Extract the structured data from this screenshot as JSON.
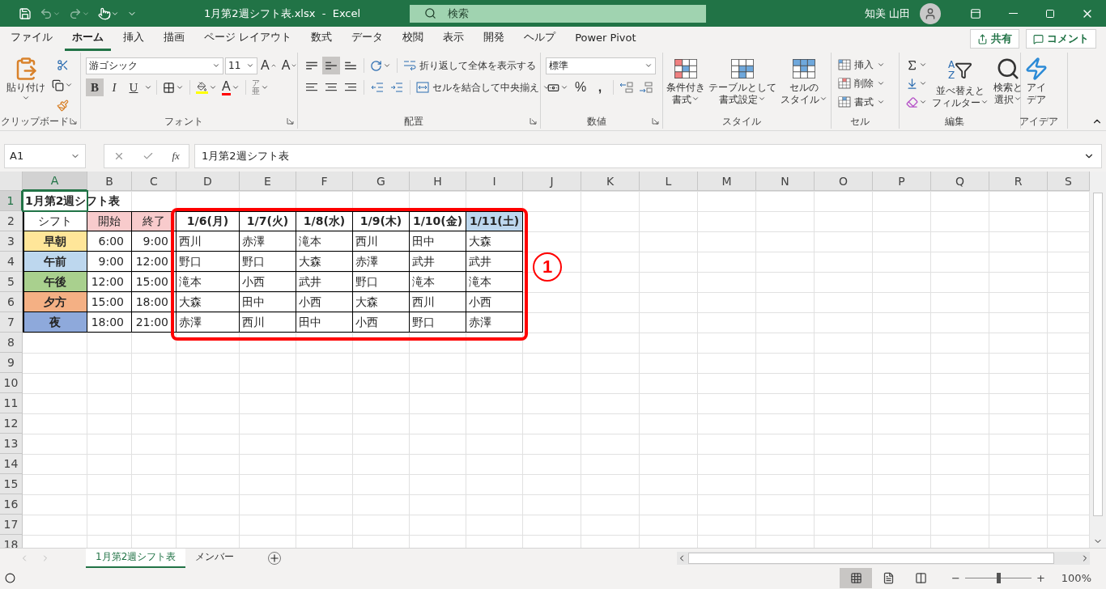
{
  "title_bar": {
    "file_title": "1月第2週シフト表.xlsx  -  Excel",
    "search_placeholder": "検索",
    "user_name": "知美 山田"
  },
  "menu_tabs": [
    {
      "label": "ファイル",
      "selected": false
    },
    {
      "label": "ホーム",
      "selected": true
    },
    {
      "label": "挿入",
      "selected": false
    },
    {
      "label": "描画",
      "selected": false
    },
    {
      "label": "ページ レイアウト",
      "selected": false
    },
    {
      "label": "数式",
      "selected": false
    },
    {
      "label": "データ",
      "selected": false
    },
    {
      "label": "校閲",
      "selected": false
    },
    {
      "label": "表示",
      "selected": false
    },
    {
      "label": "開発",
      "selected": false
    },
    {
      "label": "ヘルプ",
      "selected": false
    },
    {
      "label": "Power Pivot",
      "selected": false
    }
  ],
  "share_button": "共有",
  "comment_button": "コメント",
  "ribbon": {
    "groups": [
      {
        "kind": "clipboard",
        "label": "クリップボード",
        "paste": "貼り付け"
      },
      {
        "kind": "font",
        "label": "フォント",
        "font_name": "游ゴシック",
        "font_size": "11",
        "grow": "A",
        "shrink": "A",
        "styles": [
          {
            "kind": "bold",
            "label": "B",
            "selected": true
          },
          {
            "kind": "italic",
            "label": "I",
            "selected": false
          },
          {
            "kind": "underline",
            "label": "U",
            "selected": false
          }
        ],
        "font_color_letter": "A",
        "phonetic": [
          "ア",
          "亜"
        ]
      },
      {
        "kind": "alignment",
        "label": "配置",
        "vertical": [
          {
            "kind": "top",
            "selected": false
          },
          {
            "kind": "middle",
            "selected": true
          },
          {
            "kind": "bottom",
            "selected": false
          }
        ],
        "wrap": "折り返して全体を表示する",
        "merge": "セルを結合して中央揃え"
      },
      {
        "kind": "number",
        "label": "数値",
        "format": "標準",
        "percent": "%",
        "comma": ","
      },
      {
        "kind": "styles",
        "label": "スタイル",
        "buttons": [
          {
            "kind": "conditional",
            "lines": [
              "条件付き",
              "書式"
            ]
          },
          {
            "kind": "table",
            "lines": [
              "テーブルとして",
              "書式設定"
            ]
          },
          {
            "kind": "cell",
            "lines": [
              "セルの",
              "スタイル"
            ]
          }
        ]
      },
      {
        "kind": "cells",
        "label": "セル",
        "buttons": [
          {
            "kind": "insert",
            "label": "挿入"
          },
          {
            "kind": "delete",
            "label": "削除"
          },
          {
            "kind": "format",
            "label": "書式"
          }
        ]
      },
      {
        "kind": "editing",
        "label": "編集",
        "sort_letters": [
          "A",
          "Z"
        ],
        "sort": [
          "並べ替えと",
          "フィルター"
        ],
        "find": [
          "検索と",
          "選択"
        ]
      },
      {
        "kind": "ideas",
        "label": "アイデア",
        "lines": [
          "アイ",
          "デア"
        ]
      }
    ]
  },
  "formula_bar": {
    "name_box": "A1",
    "fx": "fx",
    "formula": "1月第2週シフト表"
  },
  "sheet": {
    "columns": [
      {
        "label": "A",
        "selected": true
      },
      {
        "label": "B",
        "selected": false
      },
      {
        "label": "C",
        "selected": false
      },
      {
        "label": "D",
        "selected": false
      },
      {
        "label": "E",
        "selected": false
      },
      {
        "label": "F",
        "selected": false
      },
      {
        "label": "G",
        "selected": false
      },
      {
        "label": "H",
        "selected": false
      },
      {
        "label": "I",
        "selected": false
      },
      {
        "label": "J",
        "selected": false
      },
      {
        "label": "K",
        "selected": false
      },
      {
        "label": "L",
        "selected": false
      },
      {
        "label": "M",
        "selected": false
      },
      {
        "label": "N",
        "selected": false
      },
      {
        "label": "O",
        "selected": false
      },
      {
        "label": "P",
        "selected": false
      },
      {
        "label": "Q",
        "selected": false
      },
      {
        "label": "R",
        "selected": false
      },
      {
        "label": "S",
        "selected": false
      }
    ],
    "rows": [
      {
        "label": "1",
        "selected": true,
        "cells": [
          {
            "kind": "title",
            "text": "1月第2週シフト表"
          }
        ]
      },
      {
        "label": "2",
        "selected": false,
        "cells": [
          {
            "kind": "label",
            "text": "シフト"
          },
          {
            "kind": "label",
            "text": "開始",
            "color": "#f8cbcc"
          },
          {
            "kind": "label",
            "text": "終了",
            "color": "#f8cbcc"
          },
          {
            "kind": "day",
            "text": "1/6(月)"
          },
          {
            "kind": "day",
            "text": "1/7(火)"
          },
          {
            "kind": "day",
            "text": "1/8(水)"
          },
          {
            "kind": "day",
            "text": "1/9(木)"
          },
          {
            "kind": "day",
            "text": "1/10(金)"
          },
          {
            "kind": "day",
            "text": "1/11(土)",
            "color": "#bdd7ee"
          }
        ]
      },
      {
        "label": "3",
        "selected": false,
        "cells": [
          {
            "kind": "shift",
            "text": "早朝",
            "color": "#ffe699"
          },
          {
            "kind": "time",
            "text": "6:00"
          },
          {
            "kind": "time",
            "text": "9:00"
          },
          {
            "kind": "name",
            "text": "西川"
          },
          {
            "kind": "name",
            "text": "赤澤"
          },
          {
            "kind": "name",
            "text": "滝本"
          },
          {
            "kind": "name",
            "text": "西川"
          },
          {
            "kind": "name",
            "text": "田中"
          },
          {
            "kind": "name",
            "text": "大森"
          }
        ]
      },
      {
        "label": "4",
        "selected": false,
        "cells": [
          {
            "kind": "shift",
            "text": "午前",
            "color": "#bdd7ee"
          },
          {
            "kind": "time",
            "text": "9:00"
          },
          {
            "kind": "time",
            "text": "12:00"
          },
          {
            "kind": "name",
            "text": "野口"
          },
          {
            "kind": "name",
            "text": "野口"
          },
          {
            "kind": "name",
            "text": "大森"
          },
          {
            "kind": "name",
            "text": "赤澤"
          },
          {
            "kind": "name",
            "text": "武井"
          },
          {
            "kind": "name",
            "text": "武井"
          }
        ]
      },
      {
        "label": "5",
        "selected": false,
        "cells": [
          {
            "kind": "shift",
            "text": "午後",
            "color": "#a9d08e"
          },
          {
            "kind": "time",
            "text": "12:00"
          },
          {
            "kind": "time",
            "text": "15:00"
          },
          {
            "kind": "name",
            "text": "滝本"
          },
          {
            "kind": "name",
            "text": "小西"
          },
          {
            "kind": "name",
            "text": "武井"
          },
          {
            "kind": "name",
            "text": "野口"
          },
          {
            "kind": "name",
            "text": "滝本"
          },
          {
            "kind": "name",
            "text": "滝本"
          }
        ]
      },
      {
        "label": "6",
        "selected": false,
        "cells": [
          {
            "kind": "shift",
            "text": "夕方",
            "color": "#f4b084"
          },
          {
            "kind": "time",
            "text": "15:00"
          },
          {
            "kind": "time",
            "text": "18:00"
          },
          {
            "kind": "name",
            "text": "大森"
          },
          {
            "kind": "name",
            "text": "田中"
          },
          {
            "kind": "name",
            "text": "小西"
          },
          {
            "kind": "name",
            "text": "大森"
          },
          {
            "kind": "name",
            "text": "西川"
          },
          {
            "kind": "name",
            "text": "小西"
          }
        ]
      },
      {
        "label": "7",
        "selected": false,
        "cells": [
          {
            "kind": "shift",
            "text": "夜",
            "color": "#8ea9db"
          },
          {
            "kind": "time",
            "text": "18:00"
          },
          {
            "kind": "time",
            "text": "21:00"
          },
          {
            "kind": "name",
            "text": "赤澤"
          },
          {
            "kind": "name",
            "text": "西川"
          },
          {
            "kind": "name",
            "text": "田中"
          },
          {
            "kind": "name",
            "text": "小西"
          },
          {
            "kind": "name",
            "text": "野口"
          },
          {
            "kind": "name",
            "text": "赤澤"
          }
        ]
      },
      {
        "label": "8",
        "selected": false
      },
      {
        "label": "9",
        "selected": false
      },
      {
        "label": "10",
        "selected": false
      },
      {
        "label": "11",
        "selected": false
      },
      {
        "label": "12",
        "selected": false
      },
      {
        "label": "13",
        "selected": false
      },
      {
        "label": "14",
        "selected": false
      },
      {
        "label": "15",
        "selected": false
      },
      {
        "label": "16",
        "selected": false
      },
      {
        "label": "17",
        "selected": false
      },
      {
        "label": "18",
        "selected": false
      }
    ],
    "annotation": {
      "marker": "1"
    }
  },
  "sheet_tabs": [
    {
      "label": "1月第2週シフト表",
      "selected": true
    },
    {
      "label": "メンバー",
      "selected": false
    }
  ],
  "status_bar": {
    "views": [
      {
        "kind": "normal",
        "selected": true
      },
      {
        "kind": "page_layout",
        "selected": false
      },
      {
        "kind": "page_break",
        "selected": false
      }
    ],
    "zoom_minus": "−",
    "zoom_plus": "+",
    "zoom_slider": {
      "level": 0.5
    },
    "zoom": "100%"
  }
}
